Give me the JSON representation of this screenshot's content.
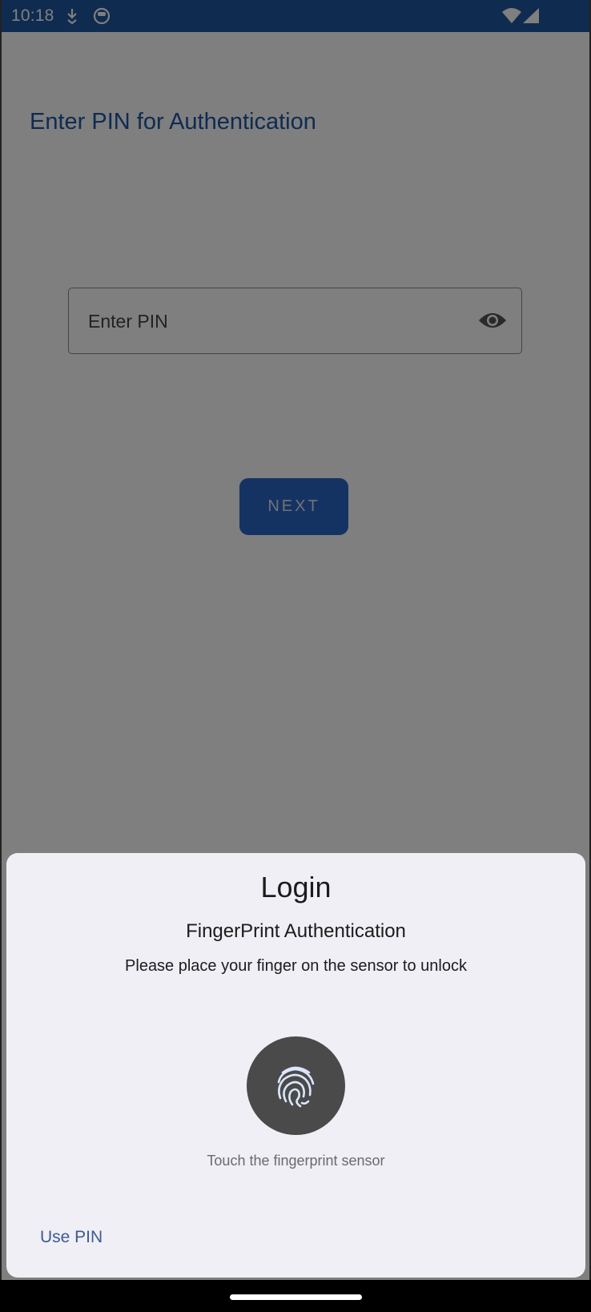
{
  "status_bar": {
    "time": "10:18",
    "icons": [
      "download-icon",
      "cat-face-icon",
      "wifi-icon",
      "cellular-signal-icon"
    ],
    "background": "#1e56a0"
  },
  "app": {
    "title": "Enter PIN for Authentication",
    "pin_field": {
      "placeholder": "Enter PIN",
      "value": "",
      "visibility_icon": "eye-icon"
    },
    "next_button_label": "NEXT",
    "accent_color": "#1e56a0"
  },
  "biometric_dialog": {
    "title": "Login",
    "subtitle": "FingerPrint Authentication",
    "description": "Please place your finger on the sensor to unlock",
    "fingerprint_icon": "fingerprint-icon",
    "hint": "Touch the fingerprint sensor",
    "negative_button_label": "Use PIN",
    "background": "#efeff5"
  }
}
